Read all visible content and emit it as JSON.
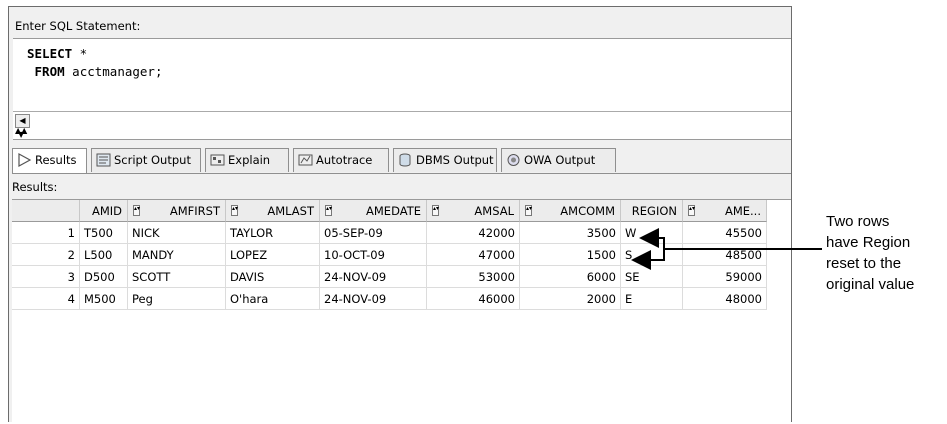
{
  "editor": {
    "label": "Enter SQL Statement:",
    "line1_kw": "SELECT",
    "line1_rest": " *",
    "line2_kw": "FROM",
    "line2_rest": " acctmanager;"
  },
  "tabs": [
    {
      "label": "Results",
      "icon": "play-icon",
      "active": true
    },
    {
      "label": "Script Output",
      "icon": "script-icon",
      "active": false
    },
    {
      "label": "Explain",
      "icon": "explain-icon",
      "active": false
    },
    {
      "label": "Autotrace",
      "icon": "autotrace-icon",
      "active": false
    },
    {
      "label": "DBMS Output",
      "icon": "dbms-icon",
      "active": false
    },
    {
      "label": "OWA Output",
      "icon": "owa-icon",
      "active": false
    }
  ],
  "results_label": "Results:",
  "grid": {
    "columns": [
      "",
      "AMID",
      "AMFIRST",
      "AMLAST",
      "AMEDATE",
      "AMSAL",
      "AMCOMM",
      "REGION",
      "AME..."
    ],
    "rows": [
      [
        "1",
        "T500",
        "NICK",
        "TAYLOR",
        "05-SEP-09",
        "42000",
        "3500",
        "W",
        "45500"
      ],
      [
        "2",
        "L500",
        "MANDY",
        "LOPEZ",
        "10-OCT-09",
        "47000",
        "1500",
        "S",
        "48500"
      ],
      [
        "3",
        "D500",
        "SCOTT",
        "DAVIS",
        "24-NOV-09",
        "53000",
        "6000",
        "SE",
        "59000"
      ],
      [
        "4",
        "M500",
        "Peg",
        "O'hara",
        "24-NOV-09",
        "46000",
        "2000",
        "E",
        "48000"
      ]
    ]
  },
  "annotation": {
    "line1": "Two rows",
    "line2": "have Region",
    "line3": "reset to the",
    "line4": "original value"
  }
}
